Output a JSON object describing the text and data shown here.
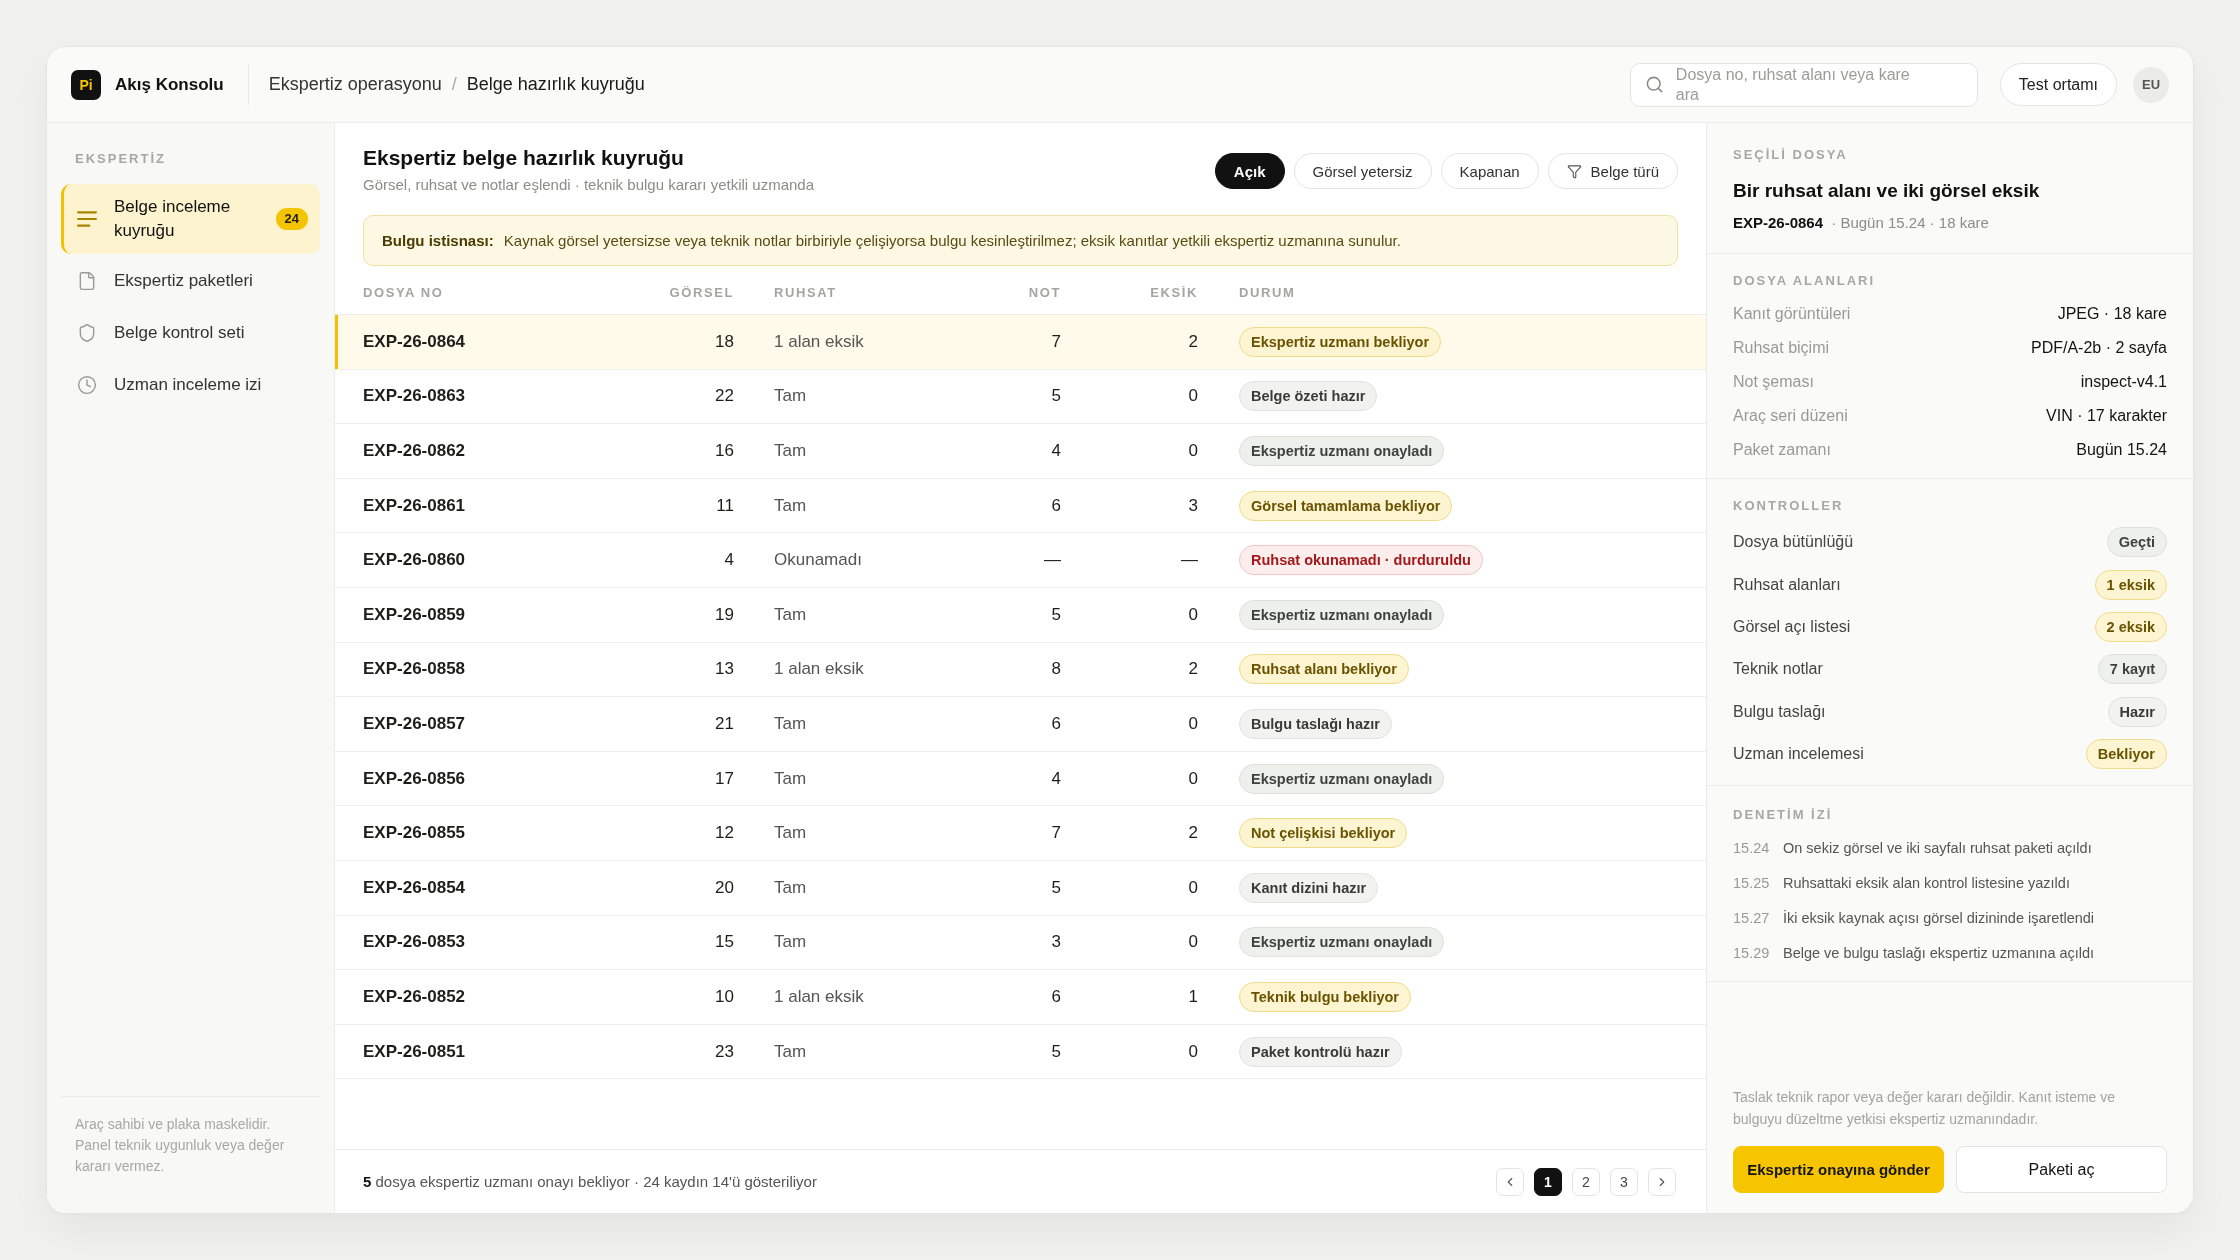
{
  "topbar": {
    "logo": "Pi",
    "app_name": "Akış Konsolu",
    "breadcrumb": [
      "Ekspertiz operasyonu",
      "Belge hazırlık kuyruğu"
    ],
    "breadcrumb_separator": "/",
    "search": {
      "placeholder": "Dosya no, ruhsat alanı veya kare ara"
    },
    "environment_button": "Test ortamı",
    "avatar": "EU"
  },
  "sidebar": {
    "section": "EKSPERTİZ",
    "items": [
      {
        "label": "Belge inceleme kuyruğu",
        "selected": true,
        "badge": "24"
      },
      {
        "label": "Ekspertiz paketleri",
        "selected": false
      },
      {
        "label": "Belge kontrol seti",
        "selected": false
      },
      {
        "label": "Uzman inceleme izi",
        "selected": false
      }
    ],
    "footnote": "Araç sahibi ve plaka maskelidir. Panel teknik uygunluk veya değer kararı vermez."
  },
  "main": {
    "title": "Ekspertiz belge hazırlık kuyruğu",
    "subtitle": "Görsel, ruhsat ve notlar eşlendi · teknik bulgu kararı yetkili uzmanda",
    "filters": [
      {
        "label": "Açık",
        "selected": true,
        "kind": "toggle"
      },
      {
        "label": "Görsel yetersiz",
        "selected": false,
        "kind": "toggle"
      },
      {
        "label": "Kapanan",
        "selected": false,
        "kind": "toggle"
      },
      {
        "label": "Belge türü",
        "selected": false,
        "kind": "menu"
      }
    ],
    "notice": "**Bulgu istisnası:** Kaynak görsel yetersizse veya teknik notlar birbiriyle çelişiyorsa bulgu kesinleştirilmez; eksik kanıtlar yetkili ekspertiz uzmanına sunulur.",
    "table": {
      "columns": [
        "DOSYA NO",
        "GÖRSEL",
        "RUHSAT",
        "NOT",
        "EKSİK",
        "DURUM"
      ],
      "rows": [
        {
          "file_no": "EXP-26-0864",
          "images": "18",
          "license": "1 alan eksik",
          "notes": "7",
          "missing": "2",
          "status": {
            "label": "Ekspertiz uzmanı bekliyor",
            "kind": "pending"
          },
          "selected": true
        },
        {
          "file_no": "EXP-26-0863",
          "images": "22",
          "license": "Tam",
          "notes": "5",
          "missing": "0",
          "status": {
            "label": "Belge özeti hazır",
            "kind": "ready"
          },
          "selected": false
        },
        {
          "file_no": "EXP-26-0862",
          "images": "16",
          "license": "Tam",
          "notes": "4",
          "missing": "0",
          "status": {
            "label": "Ekspertiz uzmanı onayladı",
            "kind": "approved"
          },
          "selected": false
        },
        {
          "file_no": "EXP-26-0861",
          "images": "11",
          "license": "Tam",
          "notes": "6",
          "missing": "3",
          "status": {
            "label": "Görsel tamamlama bekliyor",
            "kind": "pending"
          },
          "selected": false
        },
        {
          "file_no": "EXP-26-0860",
          "images": "4",
          "license": "Okunamadı",
          "notes": "—",
          "missing": "—",
          "status": {
            "label": "Ruhsat okunamadı · durduruldu",
            "kind": "halted"
          },
          "selected": false
        },
        {
          "file_no": "EXP-26-0859",
          "images": "19",
          "license": "Tam",
          "notes": "5",
          "missing": "0",
          "status": {
            "label": "Ekspertiz uzmanı onayladı",
            "kind": "approved"
          },
          "selected": false
        },
        {
          "file_no": "EXP-26-0858",
          "images": "13",
          "license": "1 alan eksik",
          "notes": "8",
          "missing": "2",
          "status": {
            "label": "Ruhsat alanı bekliyor",
            "kind": "pending"
          },
          "selected": false
        },
        {
          "file_no": "EXP-26-0857",
          "images": "21",
          "license": "Tam",
          "notes": "6",
          "missing": "0",
          "status": {
            "label": "Bulgu taslağı hazır",
            "kind": "ready"
          },
          "selected": false
        },
        {
          "file_no": "EXP-26-0856",
          "images": "17",
          "license": "Tam",
          "notes": "4",
          "missing": "0",
          "status": {
            "label": "Ekspertiz uzmanı onayladı",
            "kind": "approved"
          },
          "selected": false
        },
        {
          "file_no": "EXP-26-0855",
          "images": "12",
          "license": "Tam",
          "notes": "7",
          "missing": "2",
          "status": {
            "label": "Not çelişkisi bekliyor",
            "kind": "pending"
          },
          "selected": false
        },
        {
          "file_no": "EXP-26-0854",
          "images": "20",
          "license": "Tam",
          "notes": "5",
          "missing": "0",
          "status": {
            "label": "Kanıt dizini hazır",
            "kind": "ready"
          },
          "selected": false
        },
        {
          "file_no": "EXP-26-0853",
          "images": "15",
          "license": "Tam",
          "notes": "3",
          "missing": "0",
          "status": {
            "label": "Ekspertiz uzmanı onayladı",
            "kind": "approved"
          },
          "selected": false
        },
        {
          "file_no": "EXP-26-0852",
          "images": "10",
          "license": "1 alan eksik",
          "notes": "6",
          "missing": "1",
          "status": {
            "label": "Teknik bulgu bekliyor",
            "kind": "pending"
          },
          "selected": false
        },
        {
          "file_no": "EXP-26-0851",
          "images": "23",
          "license": "Tam",
          "notes": "5",
          "missing": "0",
          "status": {
            "label": "Paket kontrolü hazır",
            "kind": "ready"
          },
          "selected": false
        }
      ]
    },
    "footer": {
      "summary": "**5** dosya ekspertiz uzmanı onayı bekliyor · 24 kaydın 14'ü gösteriliyor",
      "pages": [
        {
          "label": "1",
          "selected": true
        },
        {
          "label": "2",
          "selected": false
        },
        {
          "label": "3",
          "selected": false
        }
      ]
    }
  },
  "detail": {
    "section": "SEÇİLİ DOSYA",
    "title": "Bir ruhsat alanı ve iki görsel eksik",
    "meta": "**EXP-26-0864** · Bugün 15.24 · 18 kare",
    "fields_title": "DOSYA ALANLARI",
    "fields": [
      {
        "label": "Kanıt görüntüleri",
        "value": "JPEG · 18 kare"
      },
      {
        "label": "Ruhsat biçimi",
        "value": "PDF/A-2b · 2 sayfa"
      },
      {
        "label": "Not şeması",
        "value": "inspect-v4.1"
      },
      {
        "label": "Araç seri düzeni",
        "value": "VIN · 17 karakter"
      },
      {
        "label": "Paket zamanı",
        "value": "Bugün 15.24"
      }
    ],
    "checks_title": "KONTROLLER",
    "checks": [
      {
        "label": "Dosya bütünlüğü",
        "status": {
          "label": "Geçti",
          "kind": "approved"
        }
      },
      {
        "label": "Ruhsat alanları",
        "status": {
          "label": "1 eksik",
          "kind": "pending"
        }
      },
      {
        "label": "Görsel açı listesi",
        "status": {
          "label": "2 eksik",
          "kind": "pending"
        }
      },
      {
        "label": "Teknik notlar",
        "status": {
          "label": "7 kayıt",
          "kind": "approved"
        }
      },
      {
        "label": "Bulgu taslağı",
        "status": {
          "label": "Hazır",
          "kind": "ready"
        }
      },
      {
        "label": "Uzman incelemesi",
        "status": {
          "label": "Bekliyor",
          "kind": "pending"
        }
      }
    ],
    "audit_title": "DENETİM İZİ",
    "audit": [
      {
        "time": "15.24",
        "text": "On sekiz görsel ve iki sayfalı ruhsat paketi açıldı"
      },
      {
        "time": "15.25",
        "text": "Ruhsattaki eksik alan kontrol listesine yazıldı"
      },
      {
        "time": "15.27",
        "text": "İki eksik kaynak açısı görsel dizininde işaretlendi"
      },
      {
        "time": "15.29",
        "text": "Belge ve bulgu taslağı ekspertiz uzmanına açıldı"
      }
    ],
    "disclaimer": "Taslak teknik rapor veya değer kararı değildir. Kanıt isteme ve bulguyu düzeltme yetkisi ekspertiz uzmanındadır.",
    "actions": [
      {
        "label": "Ekspertiz onayına gönder",
        "kind": "primary"
      },
      {
        "label": "Paketi aç",
        "kind": "secondary"
      }
    ]
  }
}
